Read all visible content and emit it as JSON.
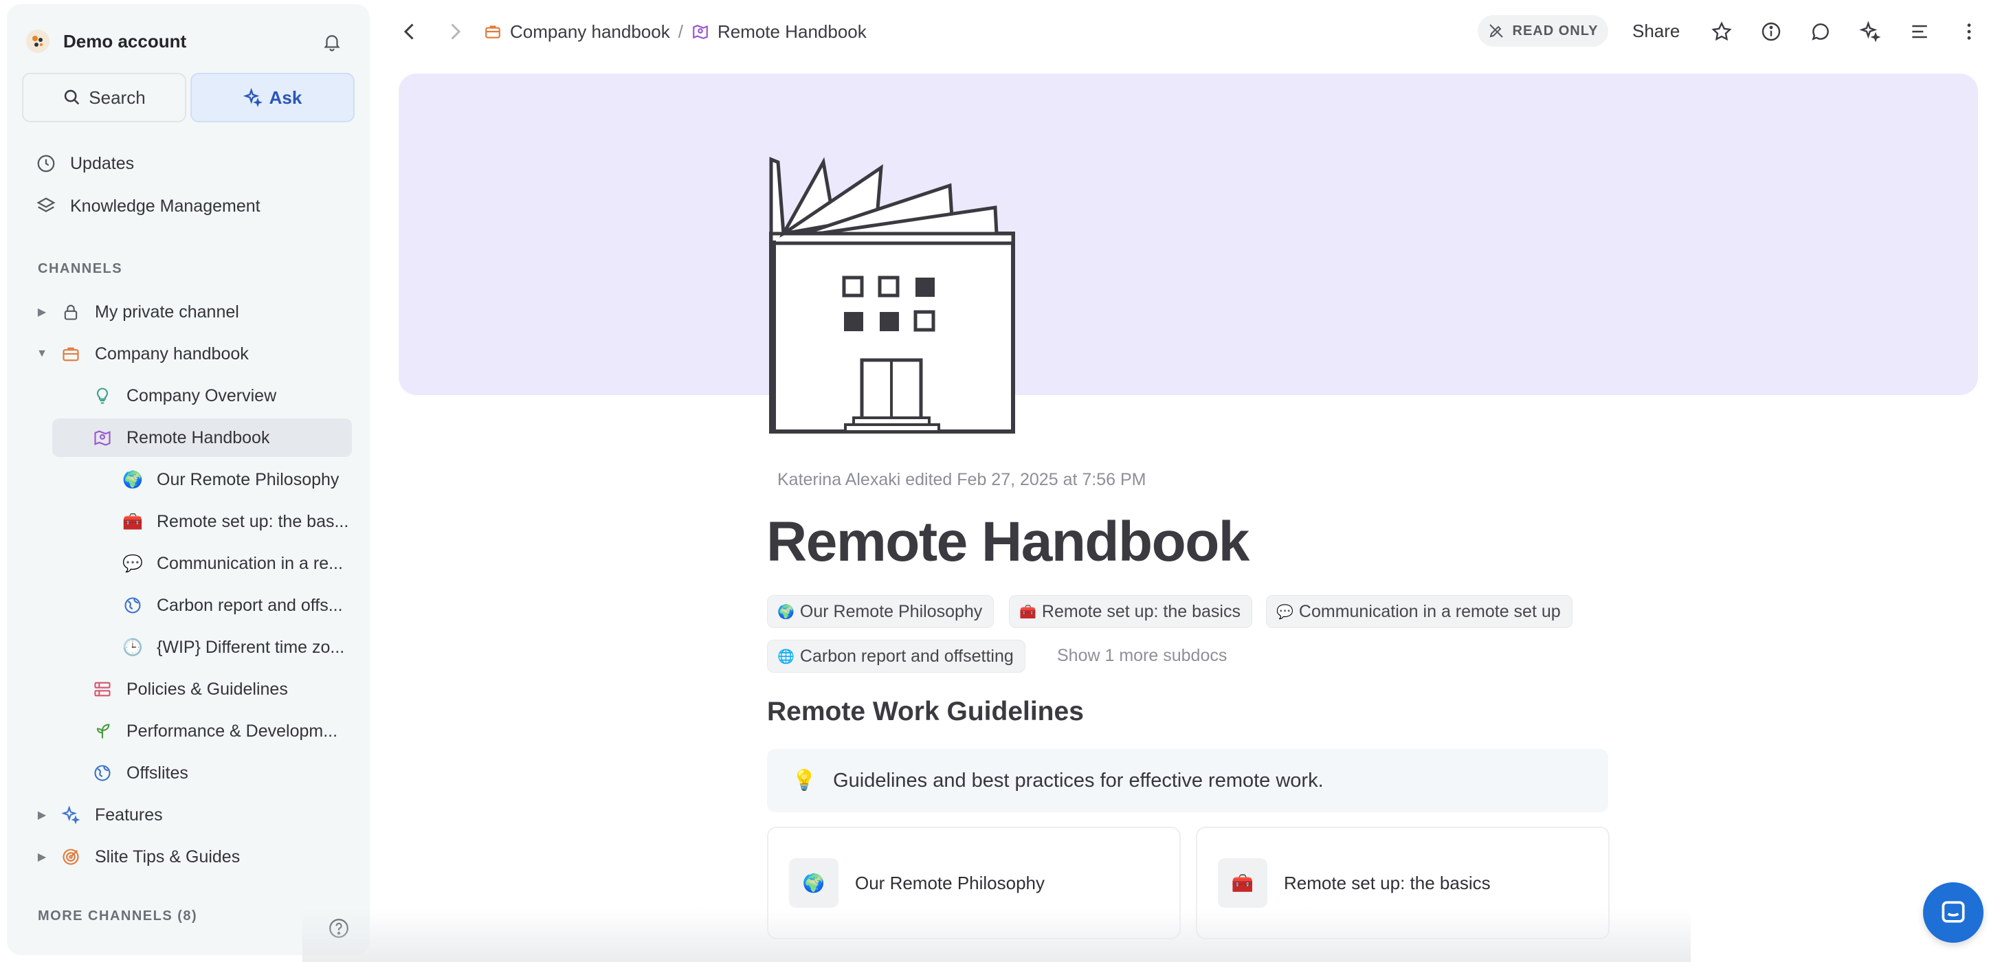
{
  "sidebar": {
    "account_name": "Demo account",
    "search_label": "Search",
    "ask_label": "Ask",
    "nav": [
      {
        "label": "Updates",
        "icon": "clock-icon"
      },
      {
        "label": "Knowledge Management",
        "icon": "layers-icon"
      }
    ],
    "channels_label": "CHANNELS",
    "tree": [
      {
        "label": "My private channel",
        "icon": "lock-icon"
      },
      {
        "label": "Company handbook",
        "icon": "briefcase-icon"
      },
      {
        "label": "Company Overview",
        "icon": "lightbulb-icon"
      },
      {
        "label": "Remote Handbook",
        "icon": "map-icon"
      },
      {
        "label": "Our Remote Philosophy",
        "icon": "globe-emoji"
      },
      {
        "label": "Remote set up: the bas...",
        "icon": "toolbox-emoji"
      },
      {
        "label": "Communication in a re...",
        "icon": "speech-bubble-emoji"
      },
      {
        "label": "Carbon report and offs...",
        "icon": "globe-outline-icon"
      },
      {
        "label": "{WIP} Different time zo...",
        "icon": "clock-emoji"
      },
      {
        "label": "Policies & Guidelines",
        "icon": "policy-icon"
      },
      {
        "label": "Performance & Developm...",
        "icon": "sprout-icon"
      },
      {
        "label": "Offslites",
        "icon": "globe-outline-icon"
      },
      {
        "label": "Features",
        "icon": "sparkles-icon"
      },
      {
        "label": "Slite Tips & Guides",
        "icon": "target-icon"
      }
    ],
    "more_channels": "MORE CHANNELS (8)"
  },
  "topbar": {
    "breadcrumb_parent": "Company handbook",
    "breadcrumb_sep": "/",
    "breadcrumb_current": "Remote Handbook",
    "read_only": "READ ONLY",
    "share": "Share"
  },
  "doc": {
    "meta": "Katerina Alexaki edited Feb 27, 2025 at 7:56 PM",
    "title": "Remote Handbook",
    "subdocs": [
      {
        "emoji": "🌍",
        "label": "Our Remote Philosophy"
      },
      {
        "emoji": "🧰",
        "label": "Remote set up: the basics"
      },
      {
        "emoji": "💬",
        "label": "Communication in a remote set up"
      },
      {
        "emoji": "🌐",
        "label": "Carbon report and offsetting"
      }
    ],
    "show_more": "Show 1 more subdocs",
    "heading": "Remote Work Guidelines",
    "callout_emoji": "💡",
    "callout": "Guidelines and best practices for effective remote work.",
    "cards": [
      {
        "emoji": "🌍",
        "label": "Our Remote Philosophy"
      },
      {
        "emoji": "🧰",
        "label": "Remote set up: the basics"
      }
    ]
  },
  "colors": {
    "cover_bg": "#ede9fd",
    "accent": "#2a56b6",
    "sidebar_bg": "#f3f7f8",
    "fab": "#1e6fd6"
  }
}
